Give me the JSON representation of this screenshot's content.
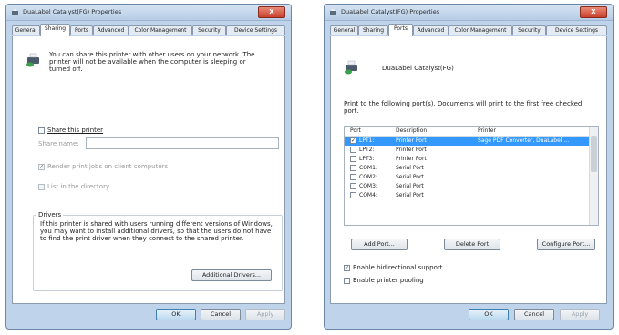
{
  "left": {
    "title": "DuaLabel Catalyst(FG) Properties",
    "close": "X",
    "tabs": [
      "General",
      "Sharing",
      "Ports",
      "Advanced",
      "Color Management",
      "Security",
      "Device Settings"
    ],
    "info_text": "You can share this printer with other users on your network. The printer will not be available when the computer is sleeping or turned off.",
    "share_label": "Share this printer",
    "share_name_label": "Share name:",
    "share_name_value": "",
    "render_label": "Render print jobs on client computers",
    "list_dir_label": "List in the directory",
    "drivers_title": "Drivers",
    "drivers_text": "If this printer is shared with users running different versions of Windows, you may want to install additional drivers, so that the users do not have to find the print driver when they connect to the shared printer.",
    "additional_drivers": "Additional Drivers...",
    "ok": "OK",
    "cancel": "Cancel",
    "apply": "Apply"
  },
  "right": {
    "title": "DuaLabel Catalyst(FG) Properties",
    "close": "X",
    "tabs": [
      "General",
      "Sharing",
      "Ports",
      "Advanced",
      "Color Management",
      "Security",
      "Device Settings"
    ],
    "printer_name": "DuaLabel Catalyst(FG)",
    "instructions": "Print to the following port(s). Documents will print to the first free checked port.",
    "columns": {
      "port": "Port",
      "description": "Description",
      "printer": "Printer"
    },
    "ports": [
      {
        "port": "LPT1:",
        "description": "Printer Port",
        "printer": "Sage PDF Converter, DuaLabel ...",
        "checked": true,
        "selected": true
      },
      {
        "port": "LPT2:",
        "description": "Printer Port",
        "printer": "",
        "checked": false,
        "selected": false
      },
      {
        "port": "LPT3:",
        "description": "Printer Port",
        "printer": "",
        "checked": false,
        "selected": false
      },
      {
        "port": "COM1:",
        "description": "Serial Port",
        "printer": "",
        "checked": false,
        "selected": false
      },
      {
        "port": "COM2:",
        "description": "Serial Port",
        "printer": "",
        "checked": false,
        "selected": false
      },
      {
        "port": "COM3:",
        "description": "Serial Port",
        "printer": "",
        "checked": false,
        "selected": false
      },
      {
        "port": "COM4:",
        "description": "Serial Port",
        "printer": "",
        "checked": false,
        "selected": false
      }
    ],
    "add_port": "Add Port...",
    "delete_port": "Delete Port",
    "configure_port": "Configure Port...",
    "bidirectional_label": "Enable bidirectional support",
    "pooling_label": "Enable printer pooling",
    "ok": "OK",
    "cancel": "Cancel",
    "apply": "Apply"
  }
}
